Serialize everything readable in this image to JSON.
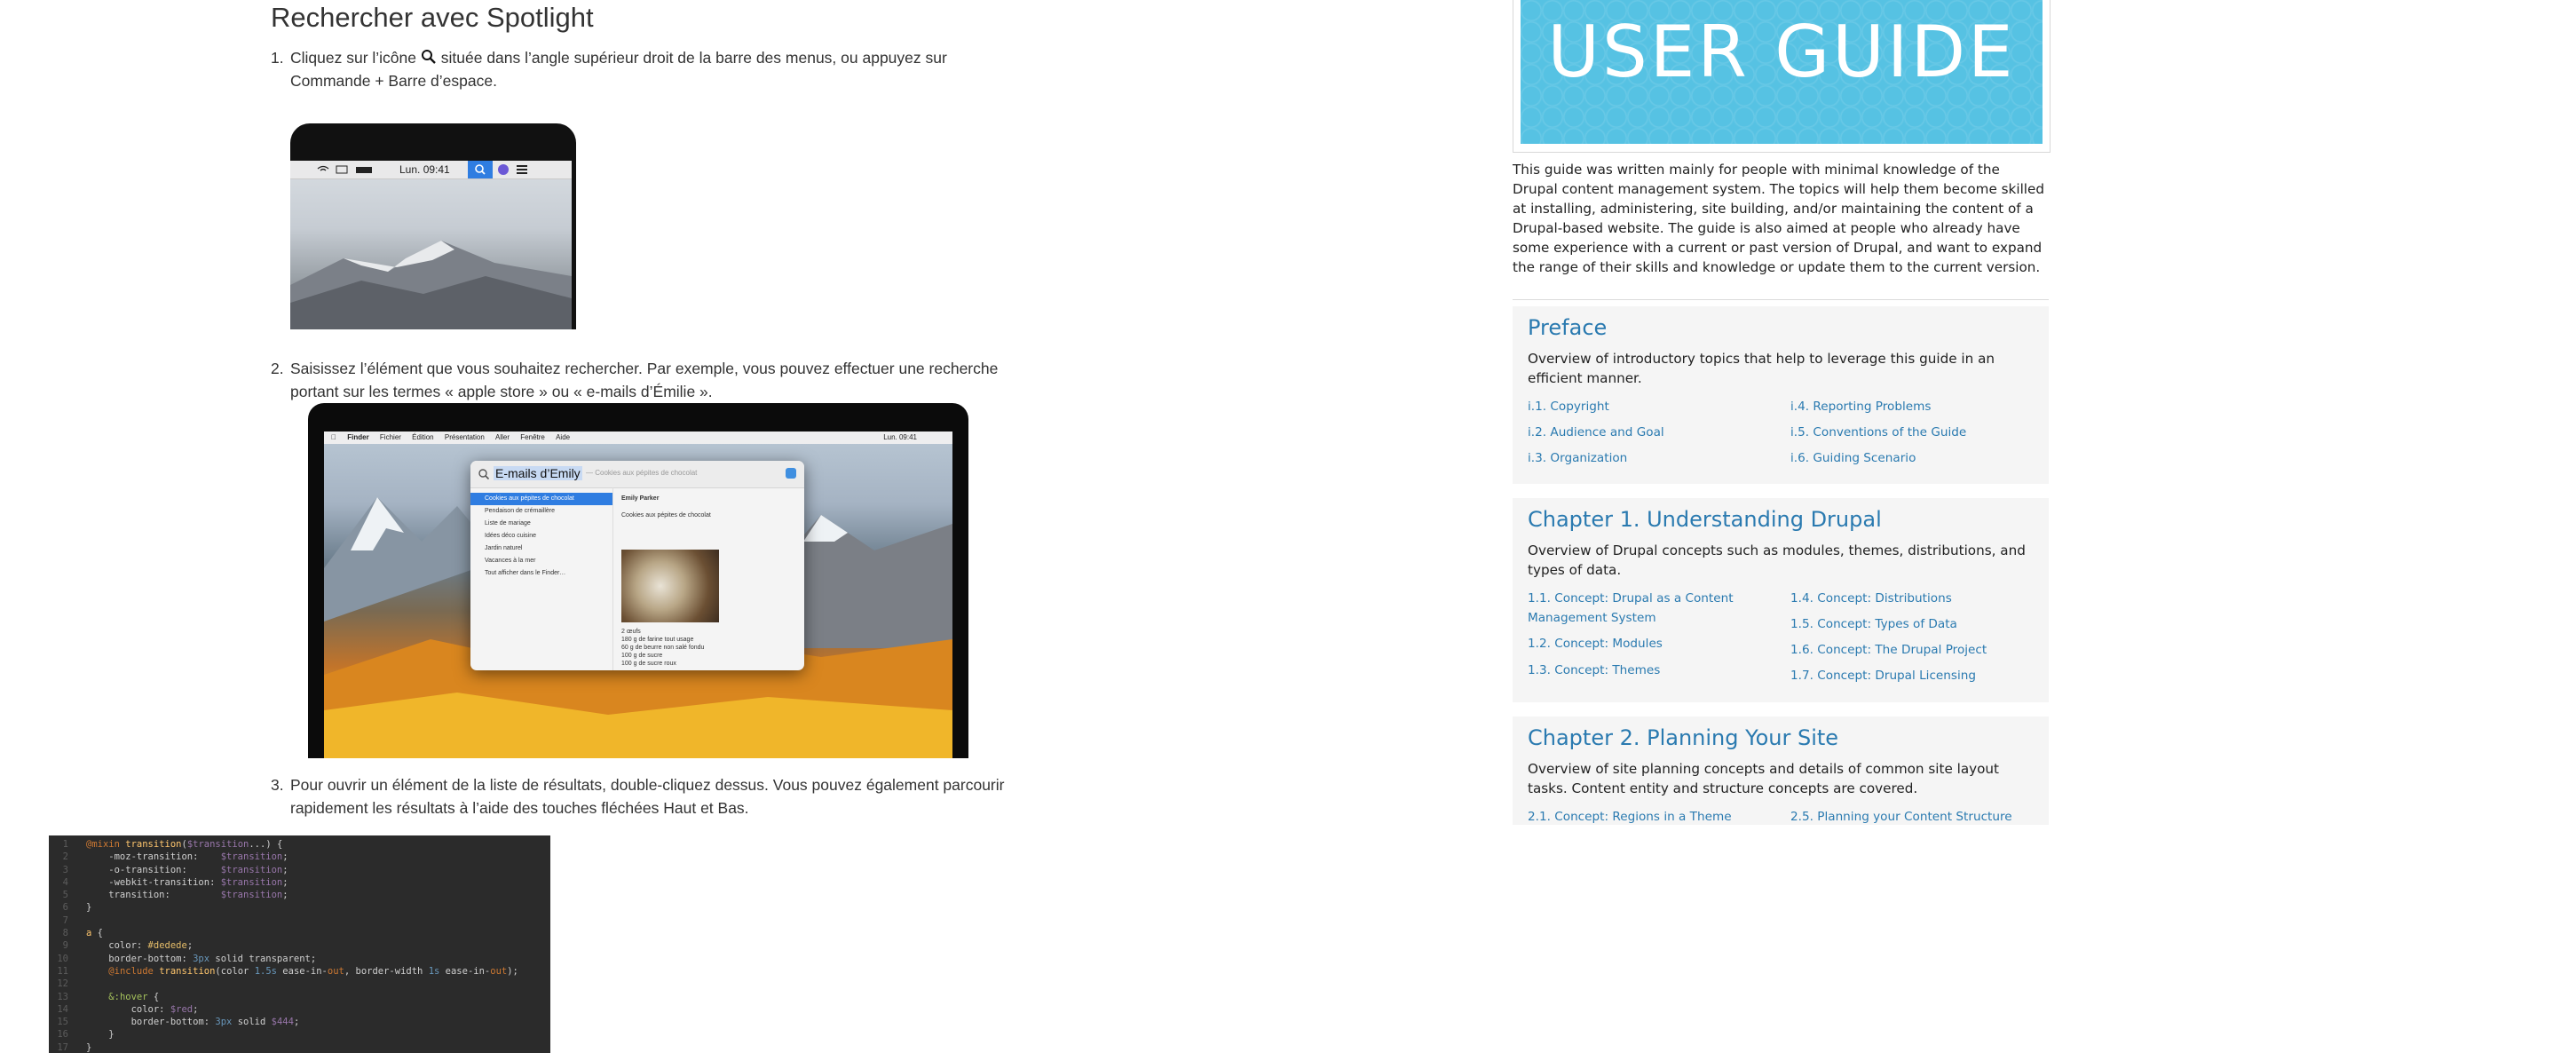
{
  "help": {
    "title": "Rechercher avec Spotlight",
    "steps": [
      {
        "num": "1.",
        "pre": "Cliquez sur l’icône",
        "post": " située dans l’angle supérieur droit de la barre des menus, ou appuyez sur",
        "line2": "Commande + Barre d’espace."
      },
      {
        "num": "2.",
        "line1": "Saisissez l’élément que vous souhaitez rechercher. Par exemple, vous pouvez effectuer une recherche",
        "line2": "portant sur les termes « apple store » ou « e-mails d’Émilie »."
      },
      {
        "num": "3.",
        "line1": "Pour ouvrir un élément de la liste de résultats, double-cliquez dessus. Vous pouvez également parcourir",
        "line2": "rapidement les résultats à l’aide des touches fléchées Haut et Bas."
      }
    ],
    "menubar_clock": "Lun. 09:41",
    "mac": {
      "menu": [
        "Finder",
        "Fichier",
        "Édition",
        "Présentation",
        "Aller",
        "Fenêtre",
        "Aide"
      ],
      "menu_clock": "Lun. 09:41",
      "query": "E-mails d’Emily",
      "query_hint": "— Cookies aux pépites de chocolat",
      "results": [
        "Cookies aux pépites de chocolat",
        "Pendaison de crémaillère",
        "Liste de mariage",
        "Idées déco cuisine",
        "Jardin naturel",
        "Vacances à la mer",
        "Tout afficher dans le Finder…"
      ],
      "preview_from": "Emily Parker",
      "preview_subject": "Cookies aux pépites de chocolat",
      "recipe": [
        "2 œufs",
        "180 g de farine tout usage",
        "60 g de beurre non salé fondu",
        "100 g de sucre",
        "100 g de sucre roux"
      ]
    },
    "code": {
      "line_numbers": [
        "1",
        "2",
        "3",
        "4",
        "5",
        "6",
        "7",
        "8",
        "9",
        "10",
        "11",
        "12",
        "13",
        "14",
        "15",
        "16",
        "17"
      ]
    }
  },
  "guide": {
    "banner": "USER GUIDE",
    "intro": "This guide was written mainly for people with minimal knowledge of the Drupal content management system. The topics will help them become skilled at installing, administering, site building, and/or maintaining the content of a Drupal-based website. The guide is also aimed at people who already have some experience with a current or past version of Drupal, and want to expand the range of their skills and knowledge or update them to the current version.",
    "sections": [
      {
        "title": "Preface",
        "desc": "Overview of introductory topics that help to leverage this guide in an efficient manner.",
        "links": [
          "i.1. Copyright",
          "i.2. Audience and Goal",
          "i.3. Organization",
          "i.4. Reporting Problems",
          "i.5. Conventions of the Guide",
          "i.6. Guiding Scenario"
        ]
      },
      {
        "title": "Chapter 1. Understanding Drupal",
        "desc": "Overview of Drupal concepts such as modules, themes, distributions, and types of data.",
        "links": [
          "1.1. Concept: Drupal as a Content Management System",
          "1.2. Concept: Modules",
          "1.3. Concept: Themes",
          "1.4. Concept: Distributions",
          "1.5. Concept: Types of Data",
          "1.6. Concept: The Drupal Project",
          "1.7. Concept: Drupal Licensing"
        ]
      },
      {
        "title": "Chapter 2. Planning Your Site",
        "desc": "Overview of site planning concepts and details of common site layout tasks. Content entity and structure concepts are covered.",
        "links": [
          "2.1. Concept: Regions in a Theme",
          "2.5. Planning your Content Structure"
        ]
      }
    ]
  }
}
